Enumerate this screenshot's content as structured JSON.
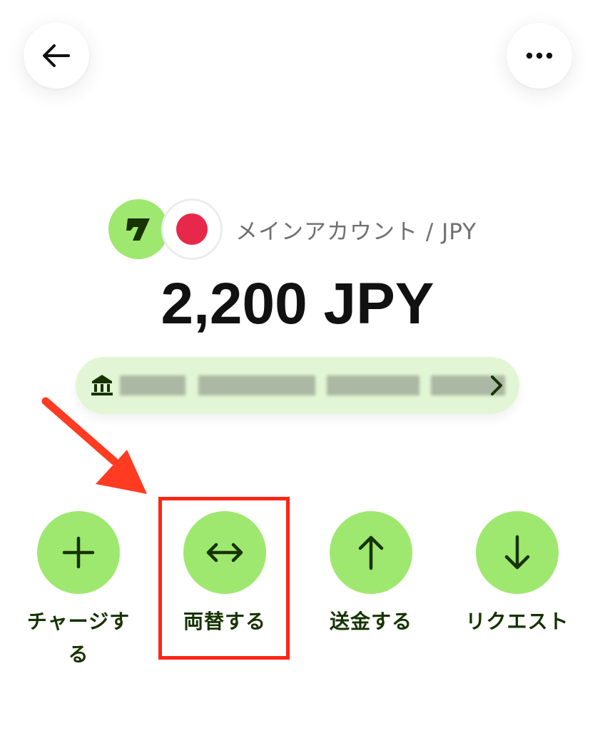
{
  "header": {
    "back_icon": "arrow-left-icon",
    "more_icon": "more-horizontal-icon"
  },
  "account": {
    "logo_icon": "wise-logo-icon",
    "flag_icon": "japan-flag-icon",
    "label": "メインアカウント / JPY"
  },
  "balance": {
    "amount": "2,200 JPY"
  },
  "bank_details": {
    "icon": "bank-icon",
    "chevron_icon": "chevron-right-icon"
  },
  "actions": [
    {
      "label": "チャージす\nる",
      "icon": "plus-icon"
    },
    {
      "label": "両替する",
      "icon": "swap-horizontal-icon"
    },
    {
      "label": "送金する",
      "icon": "arrow-up-icon"
    },
    {
      "label": "リクエスト",
      "icon": "arrow-down-icon"
    }
  ],
  "colors": {
    "brand_green": "#9fe870",
    "pill_green": "#e2f6d5",
    "label_dark_green": "#163300",
    "annotation_red": "#ff2415",
    "flag_red": "#e8284a"
  }
}
